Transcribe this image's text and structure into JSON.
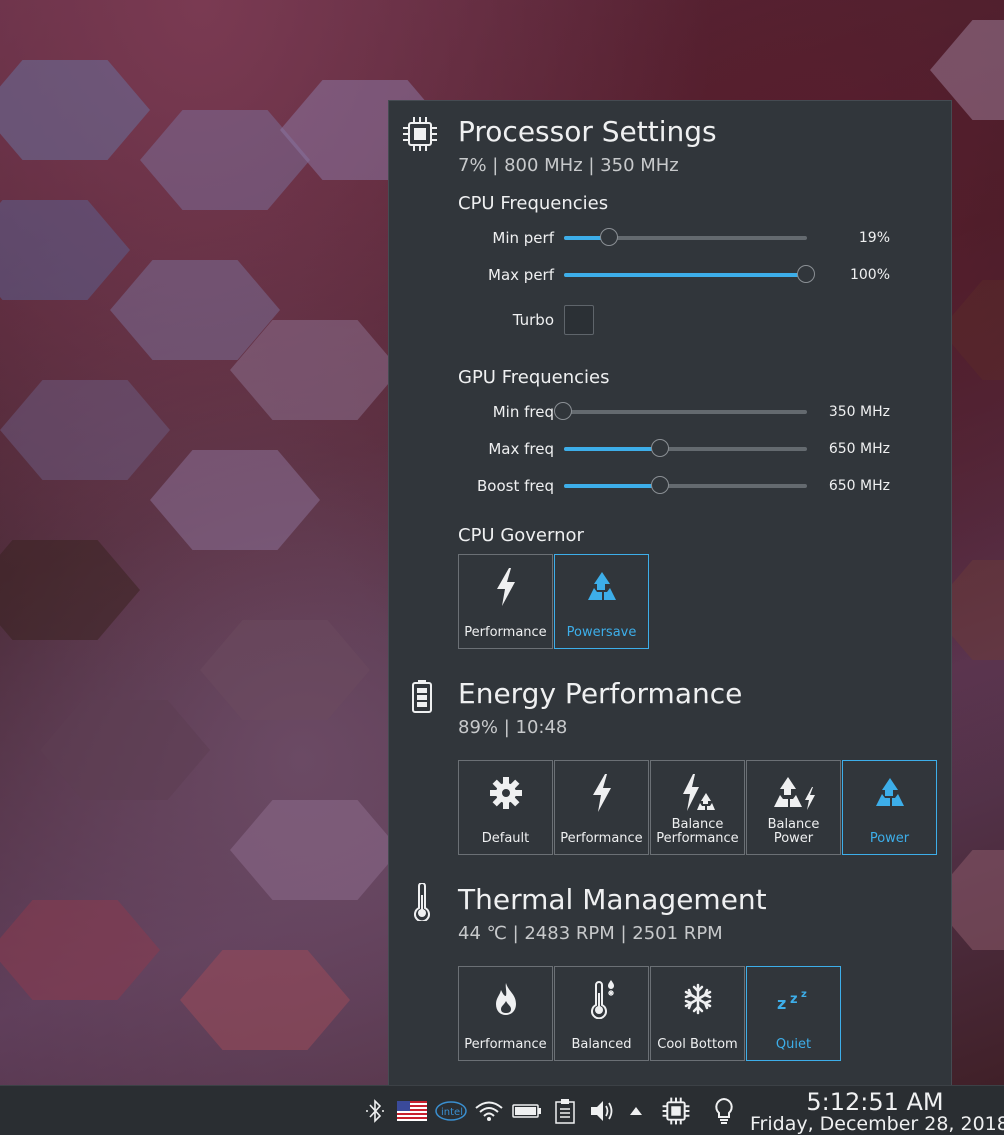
{
  "processor": {
    "title": "Processor Settings",
    "subtitle": "7% | 800 MHz | 350 MHz",
    "icon": "cpu-chip-icon",
    "cpu_freq": {
      "title": "CPU Frequencies",
      "min_label": "Min perf",
      "min_value": "19%",
      "min_level": 0.19,
      "max_label": "Max perf",
      "max_value": "100%",
      "max_level": 1.0,
      "turbo_label": "Turbo",
      "turbo_checked": false
    },
    "gpu_freq": {
      "title": "GPU Frequencies",
      "min_label": "Min freq",
      "min_value": "350 MHz",
      "min_level": 0.0,
      "max_label": "Max freq",
      "max_value": "650 MHz",
      "max_level": 0.4,
      "boost_label": "Boost freq",
      "boost_value": "650 MHz",
      "boost_level": 0.4
    },
    "governor": {
      "title": "CPU Governor",
      "options": [
        {
          "label": "Performance",
          "icon": "lightning-icon",
          "active": false
        },
        {
          "label": "Powersave",
          "icon": "recycle-icon",
          "active": true
        }
      ]
    }
  },
  "energy": {
    "title": "Energy Performance",
    "subtitle": "89% | 10:48",
    "icon": "battery-icon",
    "options": [
      {
        "label": "Default",
        "icon": "gear-icon",
        "active": false
      },
      {
        "label": "Performance",
        "icon": "lightning-icon",
        "active": false
      },
      {
        "label": "Balance\nPerformance",
        "icon": "lightning-recycle-icon",
        "active": false
      },
      {
        "label": "Balance\nPower",
        "icon": "recycle-lightning-icon",
        "active": false
      },
      {
        "label": "Power",
        "icon": "recycle-icon",
        "active": true
      }
    ]
  },
  "thermal": {
    "title": "Thermal Management",
    "subtitle": "44 ℃ | 2483 RPM | 2501 RPM",
    "icon": "thermometer-icon",
    "options": [
      {
        "label": "Performance",
        "icon": "flame-icon",
        "active": false
      },
      {
        "label": "Balanced",
        "icon": "thermometer-balance-icon",
        "active": false
      },
      {
        "label": "Cool Bottom",
        "icon": "snowflake-icon",
        "active": false
      },
      {
        "label": "Quiet",
        "icon": "sleep-zzz-icon",
        "active": true
      }
    ]
  },
  "taskbar": {
    "time": "5:12:51 AM",
    "date": "Friday, December 28, 2018",
    "tray_icons": [
      "bluetooth-icon",
      "us-flag-icon",
      "intel-icon",
      "wifi-icon",
      "battery-icon",
      "clipboard-icon",
      "volume-icon",
      "arrow-up-icon",
      "cpu-chip-icon",
      "lightbulb-icon"
    ]
  },
  "colors": {
    "panel": "#31363b",
    "accent": "#3daee9",
    "text": "#eff0f1"
  }
}
